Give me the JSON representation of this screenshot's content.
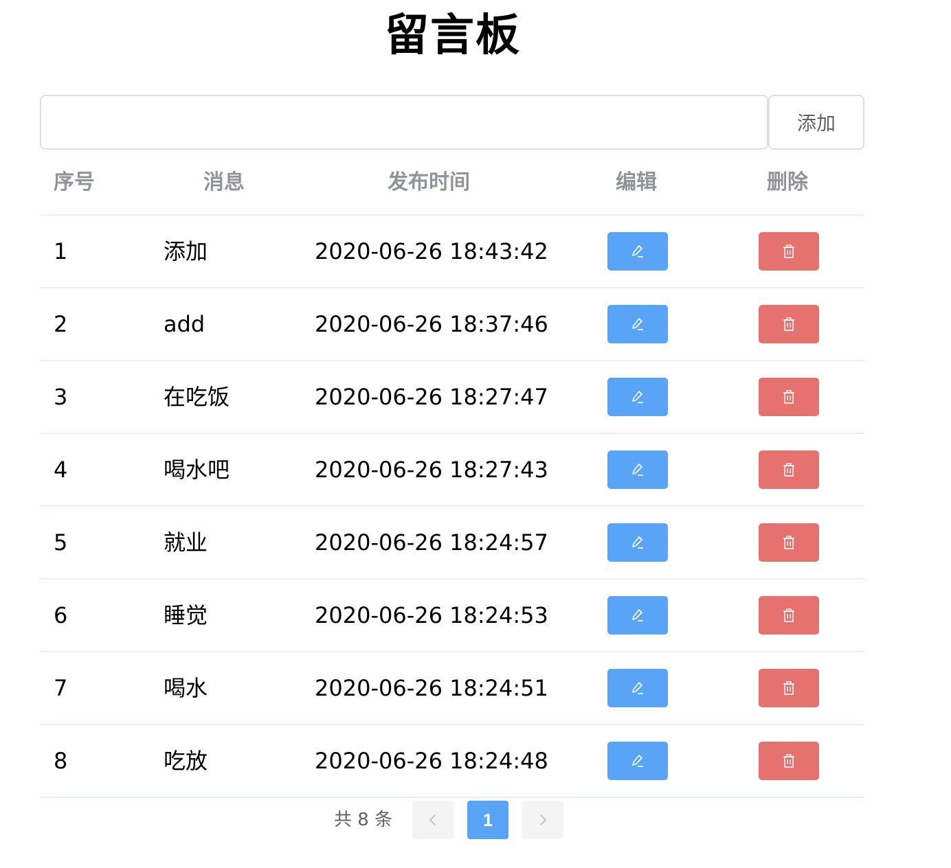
{
  "title": "留言板",
  "add_bar": {
    "input_value": "",
    "placeholder": "",
    "add_label": "添加"
  },
  "table": {
    "headers": {
      "index": "序号",
      "message": "消息",
      "time": "发布时间",
      "edit": "编辑",
      "delete": "删除"
    },
    "rows": [
      {
        "index": "1",
        "message": "添加",
        "time": "2020-06-26 18:43:42"
      },
      {
        "index": "2",
        "message": "add",
        "time": "2020-06-26 18:37:46"
      },
      {
        "index": "3",
        "message": "在吃饭",
        "time": "2020-06-26 18:27:47"
      },
      {
        "index": "4",
        "message": "喝水吧",
        "time": "2020-06-26 18:27:43"
      },
      {
        "index": "5",
        "message": "就业",
        "time": "2020-06-26 18:24:57"
      },
      {
        "index": "6",
        "message": "睡觉",
        "time": "2020-06-26 18:24:53"
      },
      {
        "index": "7",
        "message": "喝水",
        "time": "2020-06-26 18:24:51"
      },
      {
        "index": "8",
        "message": "吃放",
        "time": "2020-06-26 18:24:48"
      }
    ],
    "edit_icon": "edit-icon",
    "delete_icon": "trash-icon"
  },
  "pagination": {
    "total_text": "共 8 条",
    "current_page": "1",
    "prev_icon": "chevron-left-icon",
    "next_icon": "chevron-right-icon"
  },
  "colors": {
    "primary": "#5aa4f8",
    "danger": "#e6726f",
    "header_text": "#909399",
    "border": "#ebeef5"
  }
}
